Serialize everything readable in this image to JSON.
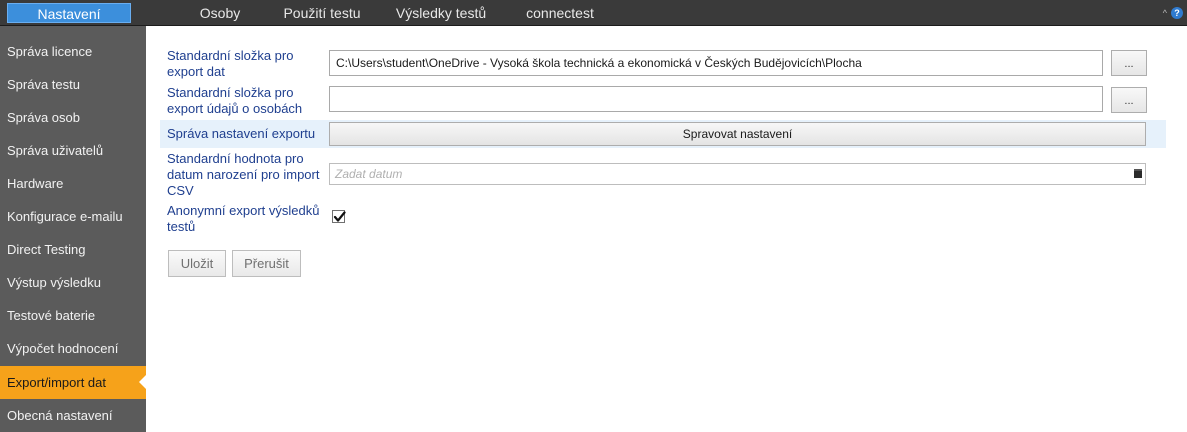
{
  "menu": {
    "tabs": [
      {
        "label": "Nastavení",
        "active": true
      },
      {
        "label": "Osoby"
      },
      {
        "label": "Použití testu"
      },
      {
        "label": "Výsledky testů"
      },
      {
        "label": "connectest"
      }
    ],
    "collapse_icon": "chevron-up-icon",
    "help_icon": "help-icon",
    "help_glyph": "?"
  },
  "sidebar": {
    "items": [
      {
        "label": "Správa licence"
      },
      {
        "label": "Správa testu"
      },
      {
        "label": "Správa osob"
      },
      {
        "label": "Správa uživatelů"
      },
      {
        "label": "Hardware"
      },
      {
        "label": "Konfigurace e-mailu"
      },
      {
        "label": "Direct Testing"
      },
      {
        "label": "Výstup výsledku"
      },
      {
        "label": "Testové baterie"
      },
      {
        "label": "Výpočet hodnocení"
      },
      {
        "label": "Export/import dat",
        "active": true
      },
      {
        "label": "Obecná nastavení"
      }
    ]
  },
  "form": {
    "export_folder": {
      "label": "Standardní složka pro export dat",
      "value": "C:\\Users\\student\\OneDrive - Vysoká škola technická a ekonomická v Českých Budějovicích\\Plocha",
      "browse_label": "..."
    },
    "person_export_folder": {
      "label": "Standardní složka pro export údajů o osobách",
      "value": "",
      "browse_label": "..."
    },
    "export_settings": {
      "label": "Správa nastavení exportu",
      "button_label": "Spravovat nastavení"
    },
    "default_birthdate": {
      "label": "Standardní hodnota pro datum narození pro import CSV",
      "placeholder": "Zadat datum",
      "icon": "calendar-icon"
    },
    "anonymous_export": {
      "label": "Anonymní export výsledků testů",
      "checked": true
    },
    "save_label": "Uložit",
    "cancel_label": "Přerušit"
  },
  "colors": {
    "menu_bg": "#3a3a3a",
    "active_tab": "#3c8fdc",
    "sidebar_bg": "#5b5b5b",
    "sidebar_active": "#f6a21a",
    "label_text": "#1f3f8f",
    "highlight_row": "#e6f1fb"
  }
}
